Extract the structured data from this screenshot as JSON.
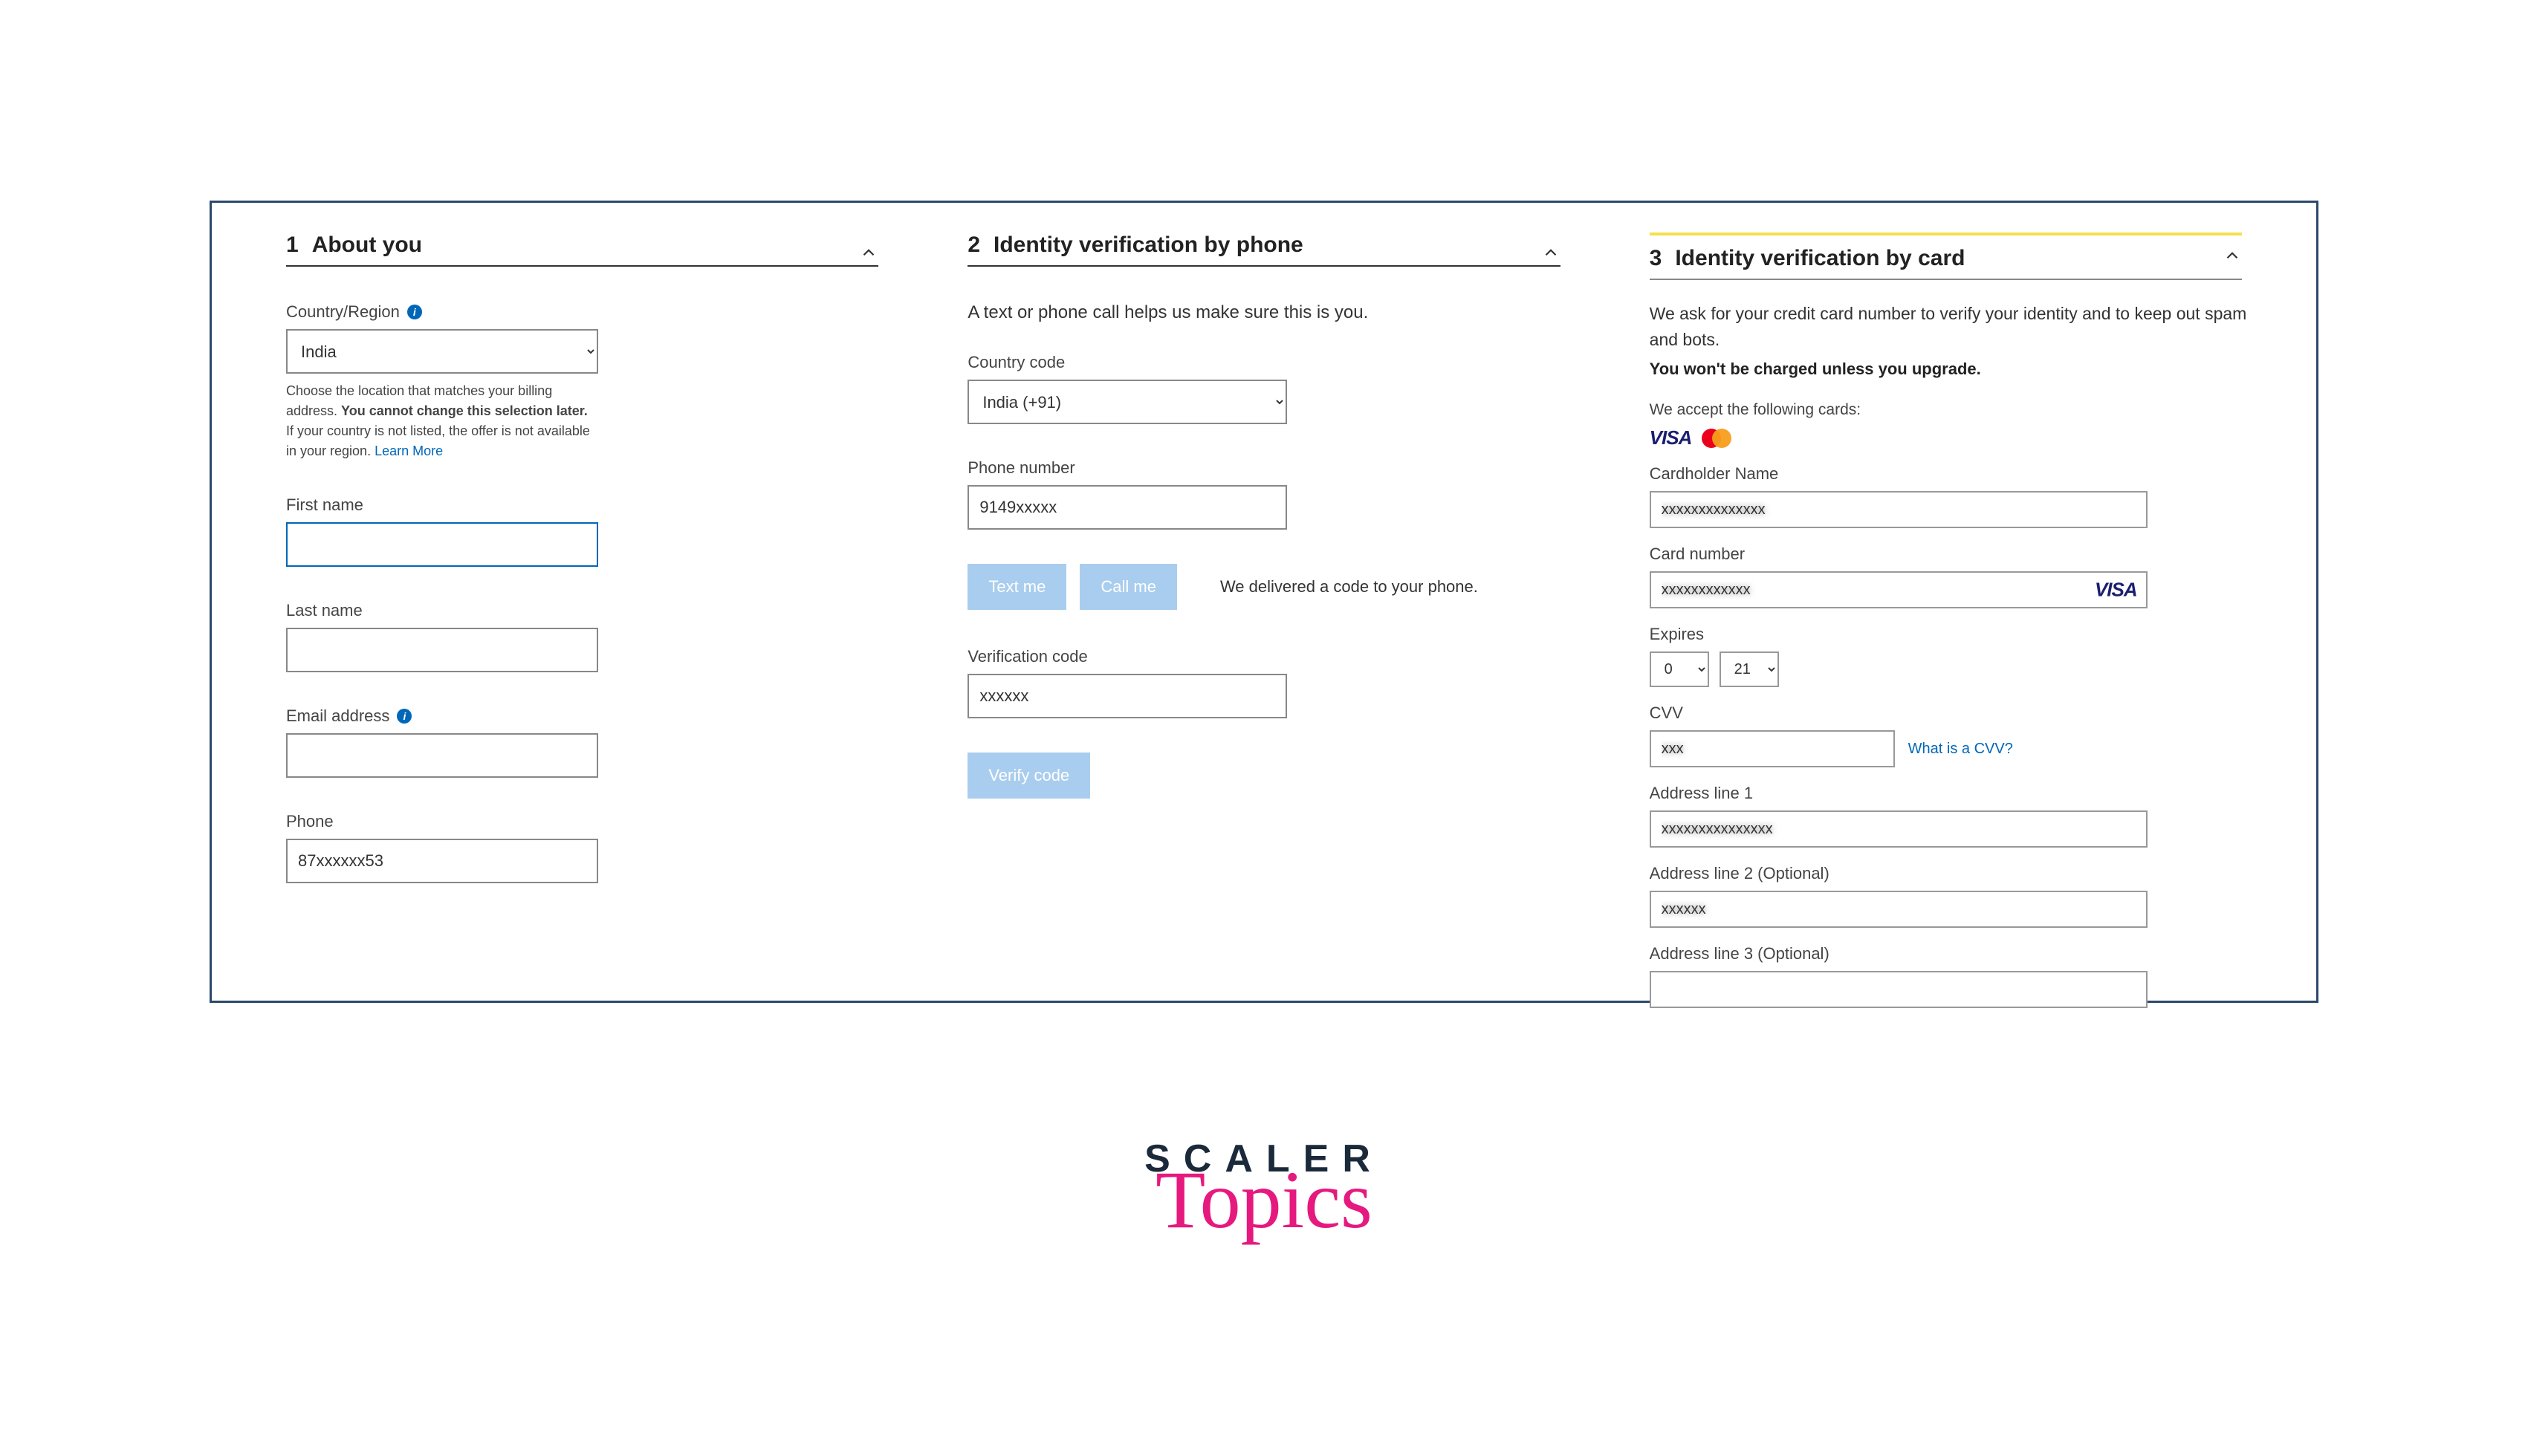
{
  "panel1": {
    "num": "1",
    "title": "About you",
    "country_label": "Country/Region",
    "country_value": "India",
    "helper_pre": "Choose the location that matches your billing address. ",
    "helper_bold": "You cannot change this selection later.",
    "helper_post": " If your country is not listed, the offer is not available in your region. ",
    "helper_link": "Learn More",
    "first_name_label": "First name",
    "first_name_value": "",
    "last_name_label": "Last name",
    "last_name_value": "",
    "email_label": "Email address",
    "email_value": "",
    "phone_label": "Phone",
    "phone_value": "87xxxxxx53"
  },
  "panel2": {
    "num": "2",
    "title": "Identity verification by phone",
    "intro": "A text or phone call helps us make sure this is you.",
    "code_label": "Country code",
    "code_value": "India (+91)",
    "phone_label": "Phone number",
    "phone_value": "9149xxxxx",
    "text_me": "Text me",
    "call_me": "Call me",
    "delivered": "We delivered a code to your phone.",
    "verif_label": "Verification code",
    "verif_value": "xxxxxx",
    "verify_btn": "Verify code"
  },
  "panel3": {
    "num": "3",
    "title": "Identity verification by card",
    "intro": "We ask for your credit card number to verify your identity and to keep out spam and bots.",
    "intro_bold": "You won't be charged unless you upgrade.",
    "accept": "We accept the following cards:",
    "cardholder_label": "Cardholder Name",
    "cardholder_value": "xxxxxxxxxxxxxx",
    "cardnum_label": "Card number",
    "cardnum_value": "xxxxxxxxxxxx",
    "expires_label": "Expires",
    "exp_month": "0",
    "exp_year": "21",
    "cvv_label": "CVV",
    "cvv_value": "xxx",
    "cvv_link": "What is a CVV?",
    "addr1_label": "Address line 1",
    "addr1_value": "xxxxxxxxxxxxxxx",
    "addr2_label": "Address line 2 (Optional)",
    "addr2_value": "xxxxxx",
    "addr3_label": "Address line 3 (Optional)",
    "addr3_value": ""
  },
  "footer": {
    "line1": "SCALER",
    "line2": "Topics"
  }
}
